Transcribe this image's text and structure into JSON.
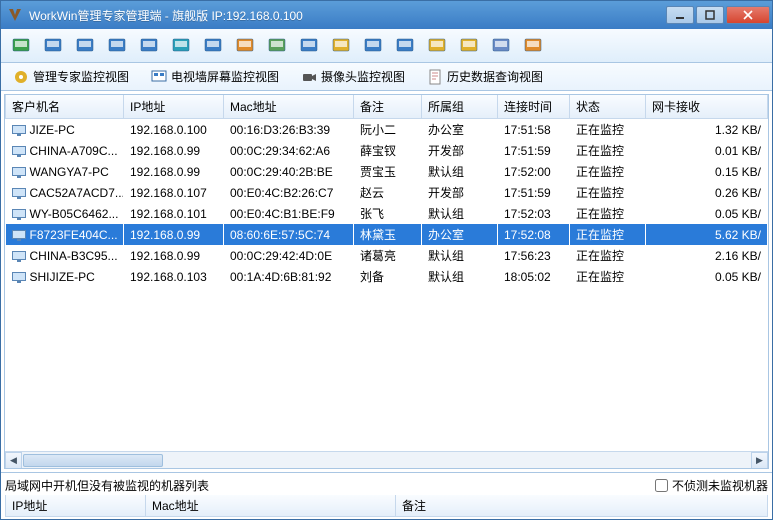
{
  "window": {
    "title": "WorkWin管理专家管理端 - 旗舰版 IP:192.168.0.100"
  },
  "tabs": [
    {
      "label": "管理专家监控视图"
    },
    {
      "label": "电视墙屏幕监控视图"
    },
    {
      "label": "摄像头监控视图"
    },
    {
      "label": "历史数据查询视图"
    }
  ],
  "columns": {
    "c0": "客户机名",
    "c1": "IP地址",
    "c2": "Mac地址",
    "c3": "备注",
    "c4": "所属组",
    "c5": "连接时间",
    "c6": "状态",
    "c7": "网卡接收"
  },
  "rows": [
    {
      "name": "JIZE-PC",
      "ip": "192.168.0.100",
      "mac": "00:16:D3:26:B3:39",
      "remark": "阮小二",
      "group": "办公室",
      "time": "17:51:58",
      "status": "正在监控",
      "net": "1.32 KB/",
      "sel": false
    },
    {
      "name": "CHINA-A709C...",
      "ip": "192.168.0.99",
      "mac": "00:0C:29:34:62:A6",
      "remark": "薛宝钗",
      "group": "开发部",
      "time": "17:51:59",
      "status": "正在监控",
      "net": "0.01 KB/",
      "sel": false
    },
    {
      "name": "WANGYA7-PC",
      "ip": "192.168.0.99",
      "mac": "00:0C:29:40:2B:BE",
      "remark": "贾宝玉",
      "group": "默认组",
      "time": "17:52:00",
      "status": "正在监控",
      "net": "0.15 KB/",
      "sel": false
    },
    {
      "name": "CAC52A7ACD7...",
      "ip": "192.168.0.107",
      "mac": "00:E0:4C:B2:26:C7",
      "remark": "赵云",
      "group": "开发部",
      "time": "17:51:59",
      "status": "正在监控",
      "net": "0.26 KB/",
      "sel": false
    },
    {
      "name": "WY-B05C6462...",
      "ip": "192.168.0.101",
      "mac": "00:E0:4C:B1:BE:F9",
      "remark": "张飞",
      "group": "默认组",
      "time": "17:52:03",
      "status": "正在监控",
      "net": "0.05 KB/",
      "sel": false
    },
    {
      "name": "F8723FE404C...",
      "ip": "192.168.0.99",
      "mac": "08:60:6E:57:5C:74",
      "remark": "林黛玉",
      "group": "办公室",
      "time": "17:52:08",
      "status": "正在监控",
      "net": "5.62 KB/",
      "sel": true
    },
    {
      "name": "CHINA-B3C95...",
      "ip": "192.168.0.99",
      "mac": "00:0C:29:42:4D:0E",
      "remark": "诸葛亮",
      "group": "默认组",
      "time": "17:56:23",
      "status": "正在监控",
      "net": "2.16 KB/",
      "sel": false
    },
    {
      "name": "SHIJIZE-PC",
      "ip": "192.168.0.103",
      "mac": "00:1A:4D:6B:81:92",
      "remark": "刘备",
      "group": "默认组",
      "time": "18:05:02",
      "status": "正在监控",
      "net": "0.05 KB/",
      "sel": false
    }
  ],
  "bottom": {
    "title": "局域网中开机但没有被监视的机器列表",
    "checkbox": "不侦测未监视机器",
    "cols": {
      "c0": "IP地址",
      "c1": "Mac地址",
      "c2": "备注"
    }
  },
  "toolbar_icons": [
    {
      "name": "tool-1",
      "c": "#3aa04a"
    },
    {
      "name": "tool-2",
      "c": "#3a7cc5"
    },
    {
      "name": "tool-3",
      "c": "#3a7cc5"
    },
    {
      "name": "tool-4",
      "c": "#3a7cc5"
    },
    {
      "name": "tool-5",
      "c": "#3a7cc5"
    },
    {
      "name": "tool-6",
      "c": "#2aa0b8"
    },
    {
      "name": "tool-7",
      "c": "#3a7cc5"
    },
    {
      "name": "tool-8",
      "c": "#e08a2a"
    },
    {
      "name": "tool-9",
      "c": "#5aa05a"
    },
    {
      "name": "tool-10",
      "c": "#3a7cc5"
    },
    {
      "name": "tool-11",
      "c": "#e0b02a"
    },
    {
      "name": "tool-12",
      "c": "#3a7cc5"
    },
    {
      "name": "tool-13",
      "c": "#3a7cc5"
    },
    {
      "name": "tool-14",
      "c": "#e0b02a"
    },
    {
      "name": "tool-15",
      "c": "#e0b02a"
    },
    {
      "name": "tool-16",
      "c": "#6a8ac5"
    },
    {
      "name": "tool-17",
      "c": "#e08a2a"
    }
  ]
}
